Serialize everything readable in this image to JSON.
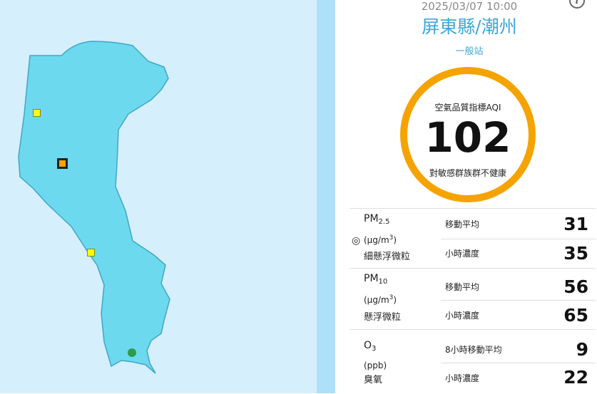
{
  "header": {
    "datetime": "2025/03/07 10:00",
    "site_name": "屏東縣/潮州",
    "site_type": "一般站",
    "info_icon": "i"
  },
  "aqi": {
    "label": "空氣品質指標AQI",
    "value": "102",
    "status": "對敏感群族群不健康",
    "ring_color": "#f5a300"
  },
  "pollutants": [
    {
      "name": "PM",
      "sub": "2.5",
      "unit_pre": "(μg/m",
      "unit_sup": "3",
      "unit_post": ")",
      "desc": "細懸浮微粒",
      "rows": [
        {
          "label": "移動平均",
          "value": "31"
        },
        {
          "label": "小時濃度",
          "value": "35"
        }
      ]
    },
    {
      "name": "PM",
      "sub": "10",
      "unit_pre": "(μg/m",
      "unit_sup": "3",
      "unit_post": ")",
      "desc": "懸浮微粒",
      "rows": [
        {
          "label": "移動平均",
          "value": "56"
        },
        {
          "label": "小時濃度",
          "value": "65"
        }
      ]
    },
    {
      "name": "O",
      "sub": "3",
      "unit_pre": "(ppb)",
      "unit_sup": "",
      "unit_post": "",
      "desc": "臭氧",
      "rows": [
        {
          "label": "8小時移動平均",
          "value": "9"
        },
        {
          "label": "小時濃度",
          "value": "22"
        }
      ]
    }
  ],
  "location_icon": "◎",
  "colors": {
    "map_water": "#d6effc",
    "map_land": "#6cd9ef",
    "divider": "#aee0fa",
    "accent": "#3fa7d6",
    "marker_yellow": "#ffff00",
    "marker_orange": "#f5a300",
    "marker_green": "#2e9b4b"
  }
}
